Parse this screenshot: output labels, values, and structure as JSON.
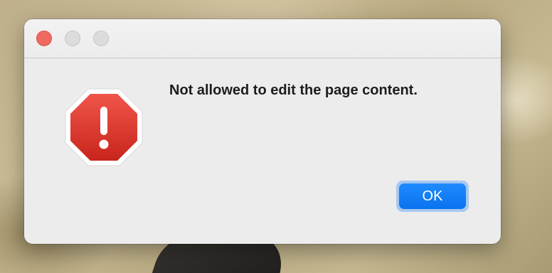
{
  "dialog": {
    "message": "Not allowed to edit the page content.",
    "ok_label": "OK",
    "icon": "stop-icon"
  },
  "colors": {
    "accent": "#0a72ee",
    "stop_red": "#d62e25",
    "close_button": "#ee6a5f"
  }
}
